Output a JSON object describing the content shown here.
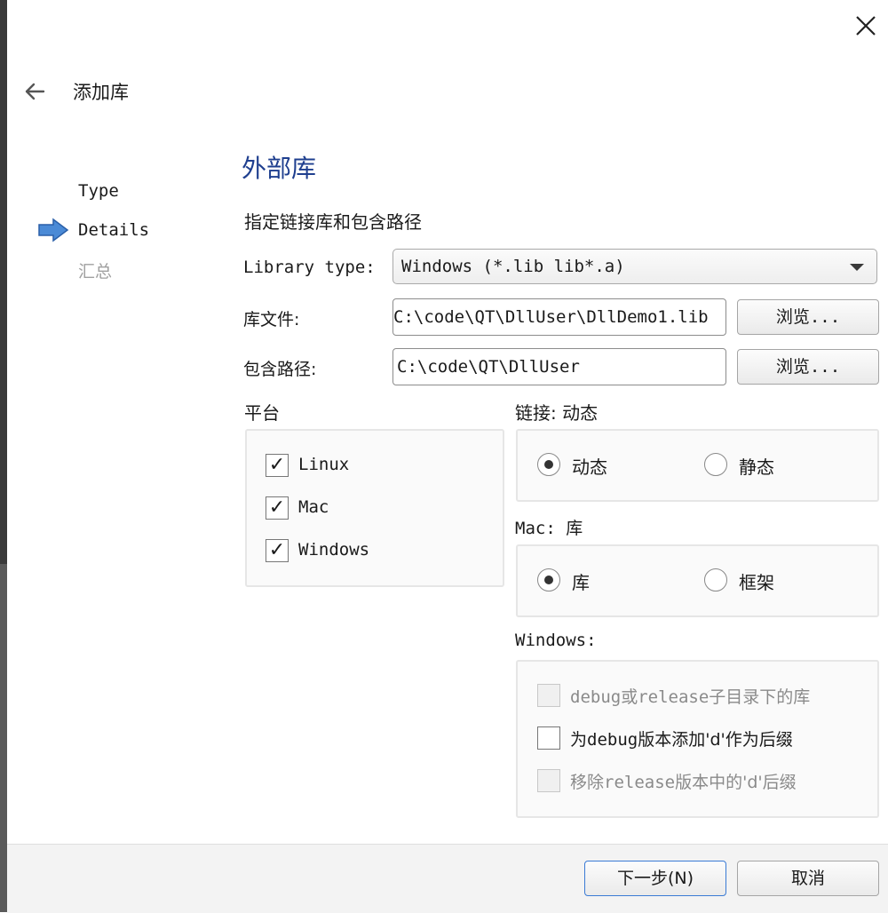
{
  "header": {
    "title": "添加库"
  },
  "steps": [
    "Type",
    "Details",
    "汇总"
  ],
  "page": {
    "title": "外部库",
    "subtitle": "指定链接库和包含路径"
  },
  "library_type": {
    "label": "Library type:",
    "value": "Windows (*.lib lib*.a)"
  },
  "library_file": {
    "label": "库文件:",
    "value": "C:\\code\\QT\\DllUser\\DllDemo1.lib",
    "browse": "浏览..."
  },
  "include_path": {
    "label": "包含路径:",
    "value": "C:\\code\\QT\\DllUser",
    "browse": "浏览..."
  },
  "platform": {
    "title": "平台",
    "options": [
      {
        "label": "Linux",
        "checked": true
      },
      {
        "label": "Mac",
        "checked": true
      },
      {
        "label": "Windows",
        "checked": true
      }
    ]
  },
  "linkage": {
    "title": "链接: 动态",
    "options": [
      {
        "label": "动态",
        "selected": true
      },
      {
        "label": "静态",
        "selected": false
      }
    ]
  },
  "mac": {
    "title": "Mac: 库",
    "options": [
      {
        "label": "库",
        "selected": true
      },
      {
        "label": "框架",
        "selected": false
      }
    ]
  },
  "windows": {
    "title": "Windows:",
    "options": [
      {
        "pre": "debug",
        "cn": "或",
        "mid": "release",
        "cn2": "子目录下的库",
        "checked": false,
        "enabled": false
      },
      {
        "pre": "",
        "cn": "为",
        "mid": "debug",
        "cn2": "版本添加'd'作为后缀",
        "checked": false,
        "enabled": true
      },
      {
        "pre": "",
        "cn": "移除",
        "mid": "release",
        "cn2": "版本中的'd'后缀",
        "checked": false,
        "enabled": false
      }
    ]
  },
  "footer": {
    "next": "下一步(N)",
    "cancel": "取消"
  },
  "icons": {
    "back": "back-arrow-icon",
    "close": "close-icon",
    "current_step": "current-step-arrow-icon"
  }
}
